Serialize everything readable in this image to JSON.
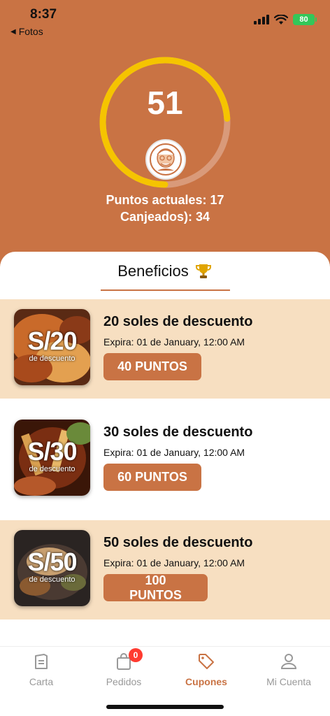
{
  "status_bar": {
    "time": "8:37",
    "back_label": "Fotos",
    "battery": "80"
  },
  "gauge": {
    "value": "51",
    "progress_fraction": 0.74,
    "fill_color": "#f5c400",
    "track_color": "#d99a7a"
  },
  "points": {
    "current": "Puntos actuales: 17",
    "redeemed": "Canjeados): 34"
  },
  "benefits": {
    "title": "Beneficios",
    "items": [
      {
        "thumb_amount": "S/20",
        "thumb_sub": "de descuento",
        "title": "20 soles de descuento",
        "expiry": "Expira: 01 de January, 12:00 AM",
        "button": "40 PUNTOS"
      },
      {
        "thumb_amount": "S/30",
        "thumb_sub": "de descuento",
        "title": "30 soles de descuento",
        "expiry": "Expira: 01 de January, 12:00 AM",
        "button": "60 PUNTOS"
      },
      {
        "thumb_amount": "S/50",
        "thumb_sub": "de descuento",
        "title": "50 soles de descuento",
        "expiry": "Expira: 01 de January, 12:00 AM",
        "button": "100 PUNTOS"
      }
    ]
  },
  "tabbar": {
    "items": [
      {
        "label": "Carta",
        "icon": "menu-doc-icon"
      },
      {
        "label": "Pedidos",
        "icon": "shopping-bag-icon",
        "badge": "0"
      },
      {
        "label": "Cupones",
        "icon": "tag-icon",
        "active": true
      },
      {
        "label": "Mi Cuenta",
        "icon": "user-icon"
      }
    ]
  },
  "colors": {
    "brand": "#c97344",
    "highlight_row": "#f7dfc1",
    "badge": "#ff3b30"
  }
}
